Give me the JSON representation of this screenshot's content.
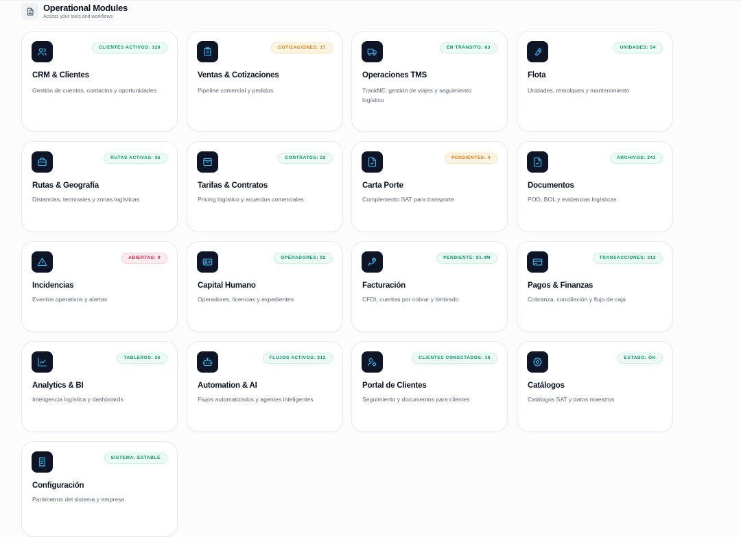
{
  "header": {
    "icon": "document-icon",
    "title": "Operational Modules",
    "subtitle": "Access your tools and workflows"
  },
  "colors": {
    "icon_bg": "#0d1526",
    "icon_stroke": "#38bdf8",
    "badge_green": "#059669",
    "badge_orange": "#d97706",
    "badge_red": "#e11d48"
  },
  "modules": [
    {
      "title": "CRM & Clientes",
      "desc": "Gestión de cuentas, contactos y oportunidades",
      "badge": "CLIENTES ACTIVOS: 128",
      "tone": "green",
      "icon": "users-icon"
    },
    {
      "title": "Ventas & Cotizaciones",
      "desc": "Pipeline comercial y pedidos",
      "badge": "COTIZACIONES: 17",
      "tone": "orange",
      "icon": "clipboard-icon"
    },
    {
      "title": "Operaciones TMS",
      "desc": "TrackNE: gestión de viajes y seguimiento logístico",
      "badge": "EN TRÁNSITO: 63",
      "tone": "green",
      "icon": "truck-icon"
    },
    {
      "title": "Flota",
      "desc": "Unidades, remolques y mantenimiento",
      "badge": "UNIDADES: 54",
      "tone": "green",
      "icon": "wrench-icon"
    },
    {
      "title": "Rutas & Geografía",
      "desc": "Distancias, terminales y zonas logísticas",
      "badge": "RUTAS ACTIVAS: 36",
      "tone": "green",
      "icon": "briefcase-icon"
    },
    {
      "title": "Tarifas & Contratos",
      "desc": "Pricing logístico y acuerdos comerciales",
      "badge": "CONTRATOS: 22",
      "tone": "green",
      "icon": "archive-icon"
    },
    {
      "title": "Carta Porte",
      "desc": "Complemento SAT para transporte",
      "badge": "PENDIENTES: 4",
      "tone": "orange",
      "icon": "file-check-icon"
    },
    {
      "title": "Documentos",
      "desc": "POD, BOL y evidencias logísticas",
      "badge": "ARCHIVOS: 241",
      "tone": "green",
      "icon": "file-check-icon"
    },
    {
      "title": "Incidencias",
      "desc": "Eventos operativos y alertas",
      "badge": "ABIERTAS: 9",
      "tone": "red",
      "icon": "alert-triangle-icon"
    },
    {
      "title": "Capital Humano",
      "desc": "Operadores, licencias y expedientes",
      "badge": "OPERADORES: 92",
      "tone": "green",
      "icon": "id-card-icon"
    },
    {
      "title": "Facturación",
      "desc": "CFDI, cuentas por cobrar y timbrado",
      "badge": "PENDIENTE: $1.4M",
      "tone": "green",
      "icon": "money-hand-icon"
    },
    {
      "title": "Pagos & Finanzas",
      "desc": "Cobranza, conciliación y flujo de caja",
      "badge": "TRANSACCIONES: 312",
      "tone": "green",
      "icon": "credit-card-icon"
    },
    {
      "title": "Analytics & BI",
      "desc": "Inteligencia logística y dashboards",
      "badge": "TABLEROS: 26",
      "tone": "green",
      "icon": "chart-line-icon"
    },
    {
      "title": "Automation & AI",
      "desc": "Flujos automatizados y agentes inteligentes",
      "badge": "FLUJOS ACTIVOS: 312",
      "tone": "green",
      "icon": "bot-icon"
    },
    {
      "title": "Portal de Clientes",
      "desc": "Seguimiento y documentos para clientes",
      "badge": "CLIENTES CONECTADOS: 18",
      "tone": "green",
      "icon": "user-cog-icon"
    },
    {
      "title": "Catálogos",
      "desc": "Catálogos SAT y datos maestros",
      "badge": "ESTADO: OK",
      "tone": "green",
      "icon": "gear-icon"
    },
    {
      "title": "Configuración",
      "desc": "Parámetros del sistema y empresa",
      "badge": "SISTEMA: ESTABLE",
      "tone": "green",
      "icon": "receipt-icon"
    }
  ]
}
